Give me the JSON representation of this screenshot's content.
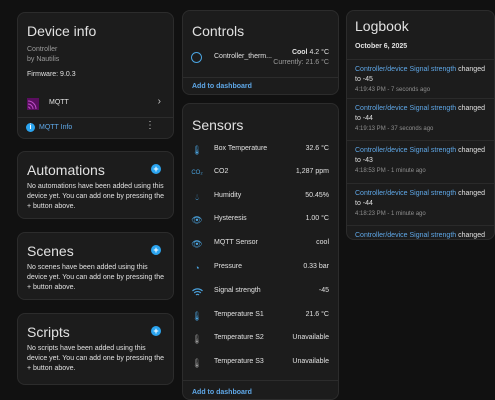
{
  "device_info": {
    "title": "Device info",
    "model": "Controller",
    "manufacturer": "by Nautilis",
    "firmware": "Firmware: 9.0.3",
    "integration": "MQTT",
    "mqtt_info": "MQTT Info"
  },
  "automations": {
    "title": "Automations",
    "description": "No automations have been added using this device yet. You can add one by pressing the + button above."
  },
  "scenes": {
    "title": "Scenes",
    "description": "No scenes have been added using this device yet. You can add one by pressing the + button above."
  },
  "scripts": {
    "title": "Scripts",
    "description": "No scripts have been added using this device yet. You can add one by pressing the + button above."
  },
  "controls": {
    "title": "Controls",
    "entity_name": "Controller_therm...",
    "state": "Cool",
    "target": "4.2 °C",
    "current": "Currently: 21.6 °C",
    "add_to_dashboard": "Add to dashboard"
  },
  "sensors": {
    "title": "Sensors",
    "items": [
      {
        "icon": "thermometer-icon",
        "label": "Box Temperature",
        "value": "32.6 °C"
      },
      {
        "icon": "co2-icon",
        "label": "CO2",
        "value": "1,287 ppm"
      },
      {
        "icon": "water-percent-icon",
        "label": "Humidity",
        "value": "50.45%"
      },
      {
        "icon": "eye-icon",
        "label": "Hysteresis",
        "value": "1.00 °C"
      },
      {
        "icon": "eye-icon",
        "label": "MQTT Sensor",
        "value": "cool"
      },
      {
        "icon": "gauge-icon",
        "label": "Pressure",
        "value": "0.33 bar"
      },
      {
        "icon": "wifi-icon",
        "label": "Signal strength",
        "value": "-45"
      },
      {
        "icon": "thermometer-icon",
        "label": "Temperature S1",
        "value": "21.6 °C"
      },
      {
        "icon": "thermometer-icon",
        "label": "Temperature S2",
        "value": "Unavailable"
      },
      {
        "icon": "thermometer-icon",
        "label": "Temperature S3",
        "value": "Unavailable"
      }
    ],
    "add_to_dashboard": "Add to dashboard"
  },
  "logbook": {
    "title": "Logbook",
    "date": "October 6, 2025",
    "entries": [
      {
        "entity": "Controller/device Signal strength",
        "action": "changed",
        "value": "to -45",
        "time": "4:19:43 PM - 7 seconds ago"
      },
      {
        "entity": "Controller/device Signal strength",
        "action": "changed",
        "value": "to -44",
        "time": "4:19:13 PM - 37 seconds ago"
      },
      {
        "entity": "Controller/device Signal strength",
        "action": "changed",
        "value": "to -43",
        "time": "4:18:53 PM - 1 minute ago"
      },
      {
        "entity": "Controller/device Signal strength",
        "action": "changed",
        "value": "to -44",
        "time": "4:18:23 PM - 1 minute ago"
      },
      {
        "entity": "Controller/device Signal strength",
        "action": "changed",
        "value": "",
        "time": ""
      }
    ]
  },
  "colors": {
    "accent": "#5fa8e8",
    "plus_button": "#2ba4ef",
    "card_bg": "#1c1c1c",
    "page_bg": "#111111"
  }
}
